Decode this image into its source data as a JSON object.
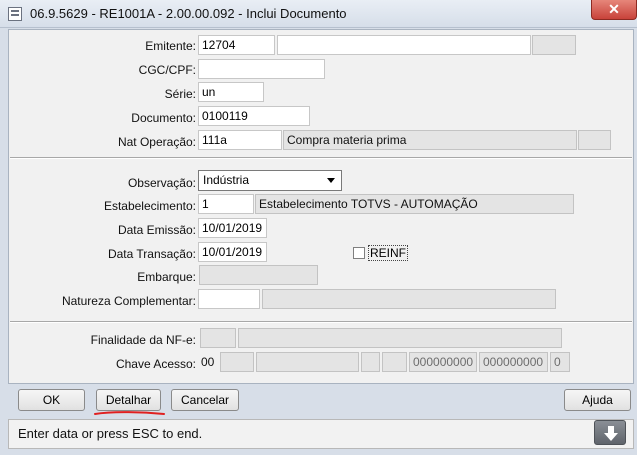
{
  "window": {
    "title": "06.9.5629 - RE1001A - 2.00.00.092 - Inclui Documento",
    "close_glyph": "✕"
  },
  "form": {
    "emitente": {
      "label": "Emitente:",
      "value": "12704",
      "desc": ""
    },
    "cgc_cpf": {
      "label": "CGC/CPF:",
      "value": ""
    },
    "serie": {
      "label": "Série:",
      "value": "un"
    },
    "documento": {
      "label": "Documento:",
      "value": "0100119"
    },
    "nat_operacao": {
      "label": "Nat Operação:",
      "value": "111a",
      "desc": "Compra materia prima"
    },
    "observacao": {
      "label": "Observação:",
      "value": "Indústria"
    },
    "estabelecimento": {
      "label": "Estabelecimento:",
      "value": "1",
      "desc": "Estabelecimento TOTVS - AUTOMAÇÃO"
    },
    "data_emissao": {
      "label": "Data Emissão:",
      "value": "10/01/2019"
    },
    "data_transacao": {
      "label": "Data Transação:",
      "value": "10/01/2019"
    },
    "reinf": {
      "label": "REINF",
      "checked": false
    },
    "embarque": {
      "label": "Embarque:",
      "value": ""
    },
    "natureza_complementar": {
      "label": "Natureza Complementar:",
      "value": ""
    },
    "finalidade_nfe": {
      "label": "Finalidade da NF-e:",
      "value": ""
    },
    "chave_acesso": {
      "label": "Chave Acesso:",
      "uf": "00",
      "numero1": "000000000",
      "numero2": "000000000",
      "dv": "0"
    }
  },
  "buttons": {
    "ok": "OK",
    "detalhar": "Detalhar",
    "cancelar": "Cancelar",
    "ajuda": "Ajuda"
  },
  "status": {
    "message": "Enter data or press ESC to end.",
    "download_icon": "arrow-down-icon"
  },
  "colors": {
    "annotation_red": "#e02020",
    "close_red": "#c8423a"
  }
}
